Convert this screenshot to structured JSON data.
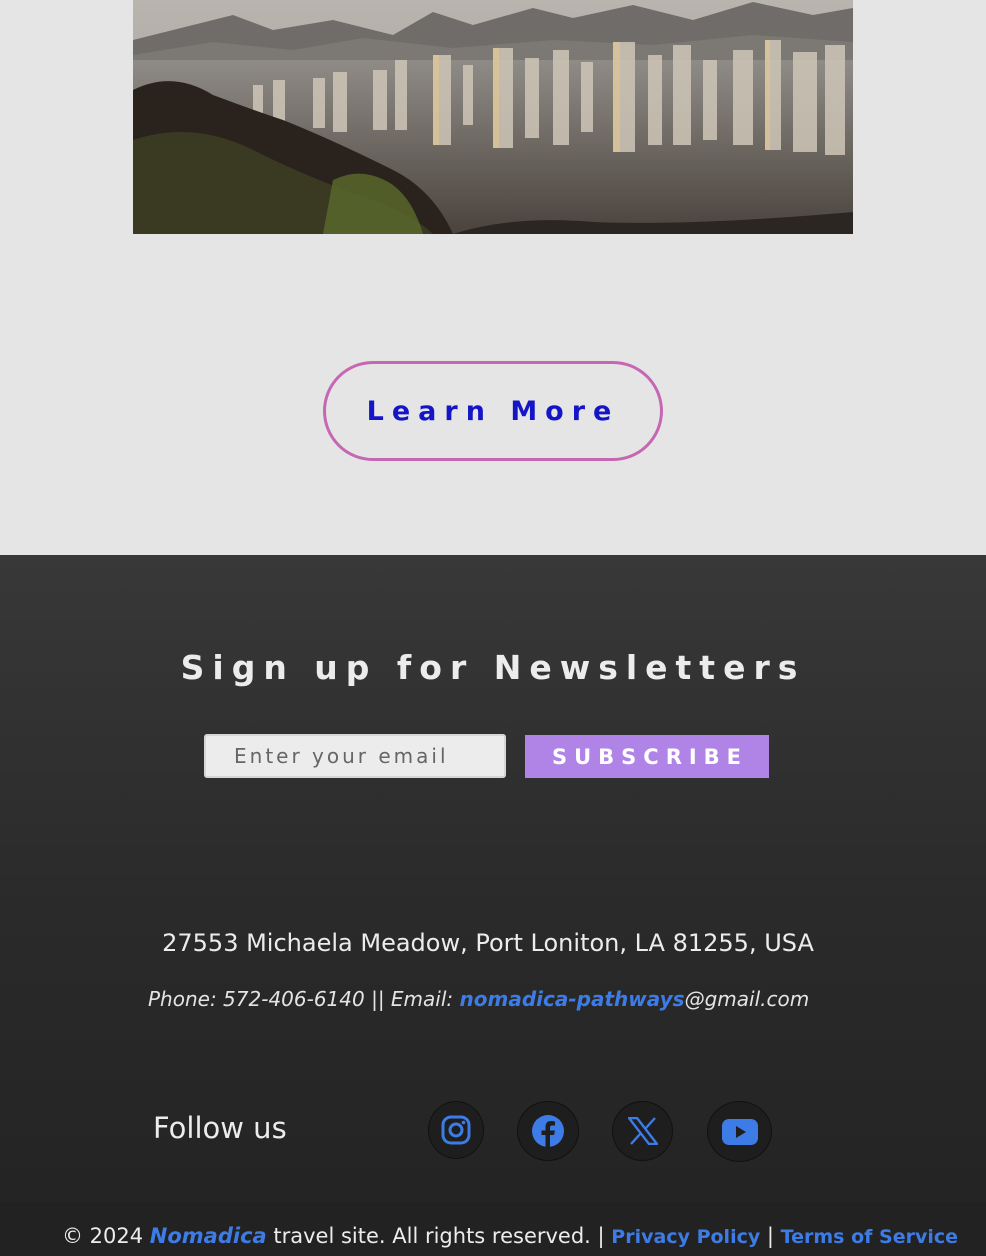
{
  "hero": {
    "image_alt": "City skyline with mountains at dusk",
    "cta_label": "Learn More"
  },
  "newsletter": {
    "title": "Sign up for Newsletters",
    "email_placeholder": "Enter your email",
    "subscribe_label": "SUBSCRIBE"
  },
  "contact": {
    "address": "27553 Michaela Meadow, Port Loniton, LA 81255, USA",
    "phone_prefix": "Phone: 572-406-6140 || Email: ",
    "email_user": "nomadica-pathways",
    "email_domain": "@gmail.com"
  },
  "social": {
    "follow_label": "Follow us",
    "icons": [
      "instagram-icon",
      "facebook-icon",
      "x-icon",
      "youtube-icon"
    ]
  },
  "copyright": {
    "prefix": "© 2024 ",
    "brand": "Nomadica",
    "middle": " travel site. All rights reserved. | ",
    "privacy_label": "Privacy Policy",
    "separator": " | ",
    "terms_label": "Terms of Service"
  },
  "colors": {
    "accent_blue": "#3d7ce6",
    "cta_text": "#1515c8",
    "cta_border": "#c567b3",
    "subscribe_bg": "#b084e6",
    "footer_bg": "#2e2e2e"
  }
}
